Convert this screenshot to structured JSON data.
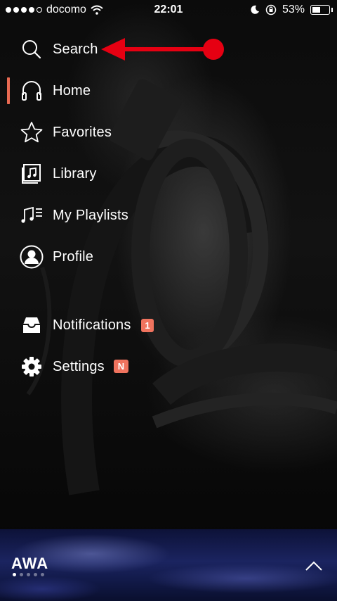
{
  "status_bar": {
    "carrier": "docomo",
    "time": "22:01",
    "battery": "53%",
    "battery_level": 0.53,
    "signal_bars": 4
  },
  "menu": {
    "items": [
      {
        "id": "search",
        "label": "Search",
        "icon": "search-icon"
      },
      {
        "id": "home",
        "label": "Home",
        "icon": "headphones-icon",
        "active": true
      },
      {
        "id": "favorites",
        "label": "Favorites",
        "icon": "star-icon"
      },
      {
        "id": "library",
        "label": "Library",
        "icon": "library-icon"
      },
      {
        "id": "playlists",
        "label": "My Playlists",
        "icon": "playlist-icon"
      },
      {
        "id": "profile",
        "label": "Profile",
        "icon": "profile-icon"
      },
      {
        "id": "notifications",
        "label": "Notifications",
        "icon": "inbox-icon",
        "badge": "1"
      },
      {
        "id": "settings",
        "label": "Settings",
        "icon": "gear-icon",
        "badge": "N"
      }
    ]
  },
  "footer": {
    "logo": "AWA",
    "pager_total": 5,
    "pager_active": 0,
    "expand_icon": "chevron-up-icon"
  },
  "colors": {
    "accent": "#e96a52",
    "badge": "#f0735e",
    "annotation_arrow": "#e60012"
  }
}
